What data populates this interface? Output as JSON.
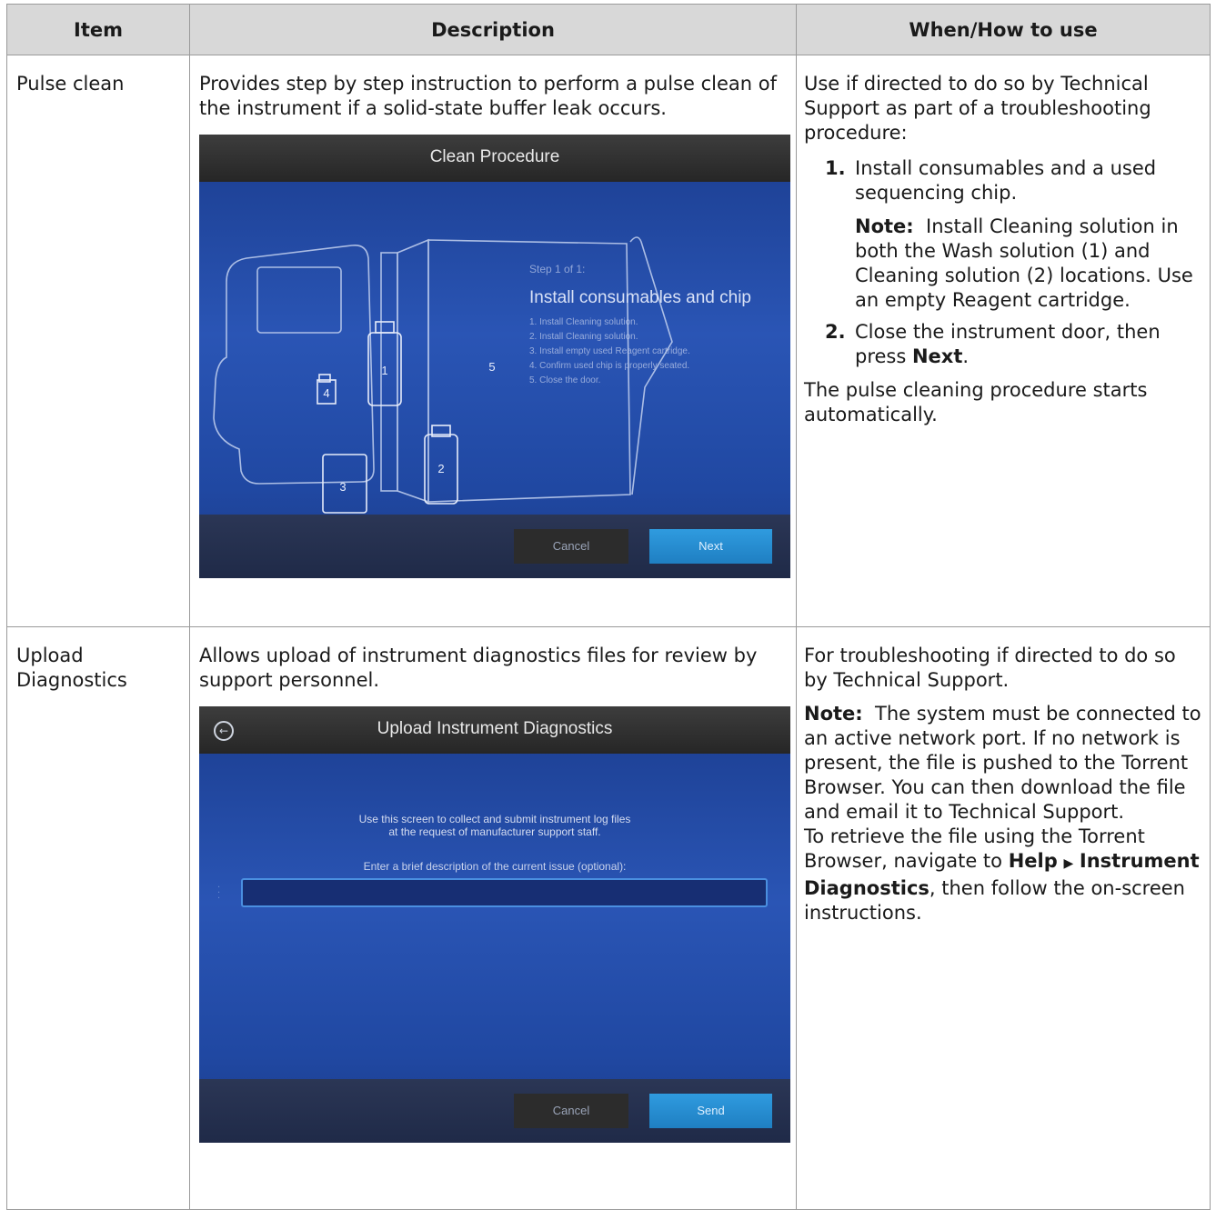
{
  "headers": {
    "item": "Item",
    "description": "Description",
    "when": "When/How to use"
  },
  "rows": [
    {
      "item": "Pulse clean",
      "description": "Provides step by step instruction to perform a pulse clean of the instrument if a solid-state buffer leak occurs.",
      "screen": {
        "title": "Clean Procedure",
        "step_label": "Step 1 of 1:",
        "step_heading": "Install consumables and chip",
        "steps": [
          "1. Install Cleaning solution.",
          "2. Install Cleaning solution.",
          "3. Install empty used Reagent cartridge.",
          "4. Confirm used chip is properly seated.",
          "5. Close the door."
        ],
        "callouts": [
          "4",
          "1",
          "5",
          "3",
          "2"
        ],
        "cancel_label": "Cancel",
        "next_label": "Next"
      },
      "when_intro": "Use if directed to do so by Technical Support as part of a troubleshooting procedure:",
      "steps": [
        {
          "num": "1.",
          "text": "Install consumables and a used sequencing chip."
        },
        {
          "num": "2.",
          "text_before": "Close the instrument door, then press ",
          "bold": "Next",
          "text_after": "."
        }
      ],
      "note_label": "Note:",
      "note_text": "Install Cleaning solution in both the Wash solution (1) and Cleaning solution (2) locations. Use an empty Reagent cartridge.",
      "when_outro": "The pulse cleaning procedure starts automatically."
    },
    {
      "item": "Upload Diagnostics",
      "description": "Allows upload of instrument diagnostics files for review by support personnel.",
      "screen": {
        "title": "Upload Instrument Diagnostics",
        "message_line1": "Use this screen to collect and submit instrument log files",
        "message_line2": "at the request of manufacturer support staff.",
        "field_label": "Enter a brief description of the current issue (optional):",
        "cancel_label": "Cancel",
        "send_label": "Send"
      },
      "when_intro": "For troubleshooting if directed to do so by Technical Support.",
      "note_label": "Note:",
      "note_text": "The system must be connected to an active network port. If no network is present, the file is pushed to the Torrent Browser. You can then download the file and email it to Technical Support.",
      "retrieve_text": "To retrieve the file using the Torrent Browser, navigate to ",
      "menu_a": "Help",
      "menu_arrow": "▶",
      "menu_b": "Instrument Diagnostics",
      "retrieve_after": ", then follow the on-screen instructions."
    }
  ]
}
